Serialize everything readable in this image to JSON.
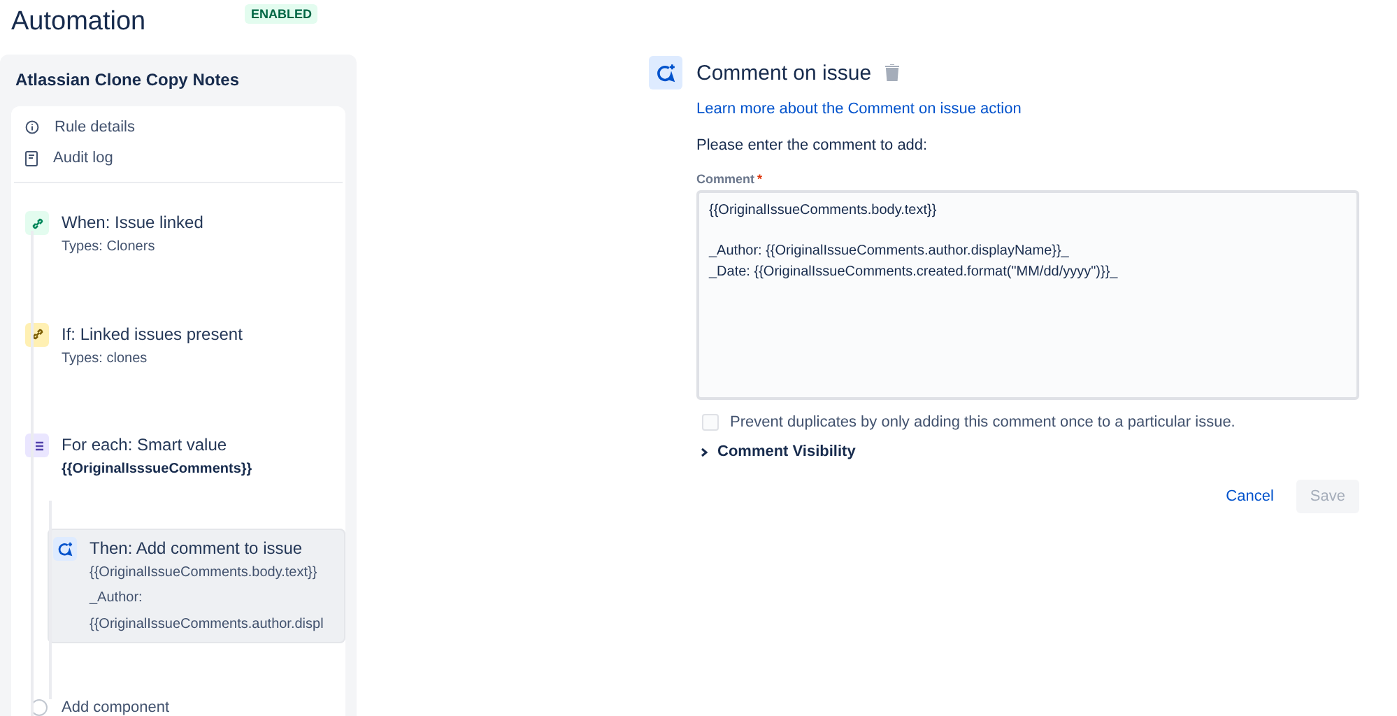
{
  "header": {
    "title": "Automation",
    "status": "ENABLED"
  },
  "sidebar": {
    "rule_name": "Atlassian Clone Copy Notes",
    "links": [
      {
        "kind": "info",
        "label": "Rule details"
      },
      {
        "kind": "log",
        "label": "Audit log"
      }
    ],
    "steps": [
      {
        "kind": "trigger",
        "title": "When: Issue linked",
        "details": [
          "Types: Cloners"
        ],
        "selected": false
      },
      {
        "kind": "condition",
        "title": "If: Linked issues present",
        "details": [
          "Types: clones"
        ],
        "selected": false
      },
      {
        "kind": "branch",
        "title": "For each: Smart value",
        "details": [
          "{{OriginalIsssueComments}}"
        ],
        "selected": false,
        "children": [
          {
            "kind": "action",
            "title": "Then: Add comment to issue",
            "details": [
              "{{OriginalIssueComments.body.text}}",
              "_Author:",
              "{{OriginalIssueComments.author.displ"
            ],
            "selected": true
          }
        ]
      }
    ],
    "add_label": "Add component"
  },
  "editor": {
    "title": "Comment on issue",
    "link": "Learn more about the Comment on issue action",
    "prompt": "Please enter the comment to add:",
    "field": {
      "label": "Comment",
      "required_mark": "*",
      "value": "{{OriginalIssueComments.body.text}}\n\n_Author: {{OriginalIssueComments.author.displayName}}_\n_Date: {{OriginalIssueComments.created.format(\"MM/dd/yyyy\")}}_"
    },
    "checkbox": {
      "label": "Prevent duplicates by only adding this comment once to a particular issue.",
      "checked": false
    },
    "section": {
      "label": "Comment Visibility",
      "expanded": false
    },
    "buttons": [
      {
        "kind": "link",
        "label": "Cancel",
        "disabled": false
      },
      {
        "kind": "primary",
        "label": "Save",
        "disabled": true
      }
    ]
  }
}
